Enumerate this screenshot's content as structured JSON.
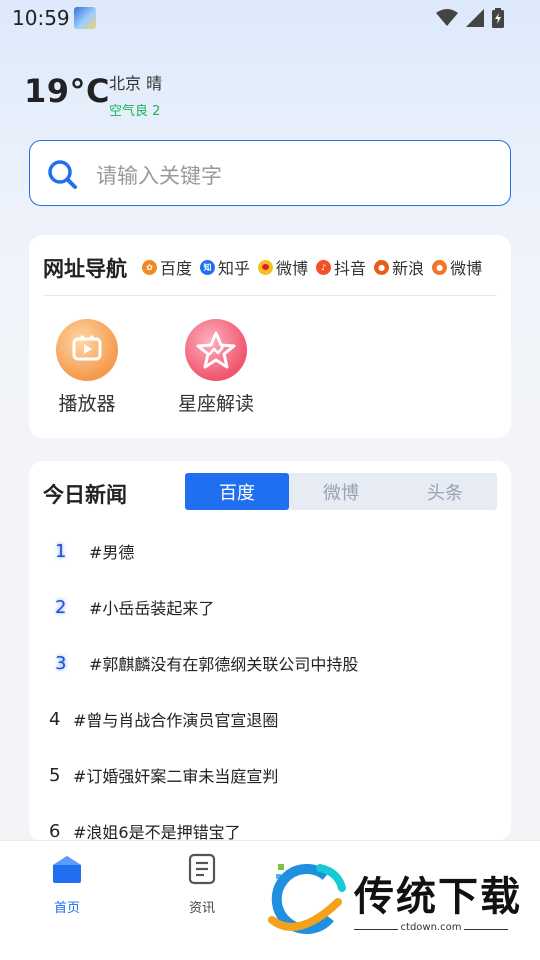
{
  "status": {
    "time": "10:59"
  },
  "weather": {
    "temperature": "19°C",
    "city_condition": "北京  晴",
    "air_quality": "空气良 2"
  },
  "search": {
    "placeholder": "请输入关键字"
  },
  "nav": {
    "title": "网址导航",
    "links": [
      {
        "label": "百度",
        "icon": "baidu-icon",
        "color": "#f08a24"
      },
      {
        "label": "知乎",
        "icon": "zhihu-icon",
        "color": "#1f6ff0"
      },
      {
        "label": "微博",
        "icon": "weibo-icon",
        "color": "#e6162d"
      },
      {
        "label": "抖音",
        "icon": "douyin-icon",
        "color": "#f5502a"
      },
      {
        "label": "新浪",
        "icon": "sina-icon",
        "color": "#e85d1a"
      },
      {
        "label": "微博",
        "icon": "weibo-icon",
        "color": "#f0742a"
      }
    ],
    "apps": [
      {
        "label": "播放器",
        "icon": "player-icon"
      },
      {
        "label": "星座解读",
        "icon": "star-icon"
      }
    ]
  },
  "news": {
    "title": "今日新闻",
    "tabs": [
      "百度",
      "微博",
      "头条"
    ],
    "active_tab": "百度",
    "items": [
      {
        "rank": "1",
        "text": "#男德"
      },
      {
        "rank": "2",
        "text": "#小岳岳装起来了"
      },
      {
        "rank": "3",
        "text": "#郭麒麟没有在郭德纲关联公司中持股"
      },
      {
        "rank": "4",
        "text": "#曾与肖战合作演员官宣退圈"
      },
      {
        "rank": "5",
        "text": "#订婚强奸案二审未当庭宣判"
      },
      {
        "rank": "6",
        "text": "#浪姐6是不是押错宝了"
      }
    ]
  },
  "bottom_nav": [
    {
      "label": "首页",
      "icon": "home-icon",
      "active": true
    },
    {
      "label": "资讯",
      "icon": "news-icon",
      "active": false
    }
  ],
  "watermark": {
    "text": "传统下载",
    "url": "ctdown.com"
  },
  "colors": {
    "accent": "#1f6ff0",
    "good_air": "#19b45a"
  }
}
